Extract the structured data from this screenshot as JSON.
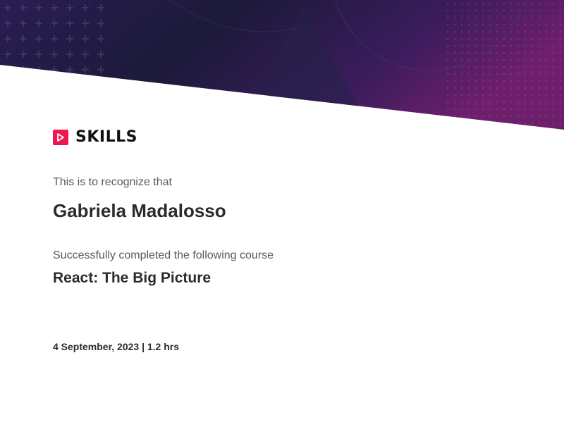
{
  "certificate": {
    "brand": "SKILLS",
    "intro_text": "This is to recognize that",
    "recipient_name": "Gabriela Madalosso",
    "completion_text": "Successfully completed the following course",
    "course_title": "React: The Big Picture",
    "date_duration": "4 September, 2023 | 1.2 hrs"
  },
  "colors": {
    "logo_accent": "#f0154f",
    "banner_dark": "#1a1838",
    "banner_purple": "#3b1a5e",
    "banner_magenta": "#6a1f6e",
    "text_primary": "#2b2b2b",
    "text_secondary": "#555a60"
  },
  "icons": {
    "logo": "play-arrow-icon"
  }
}
